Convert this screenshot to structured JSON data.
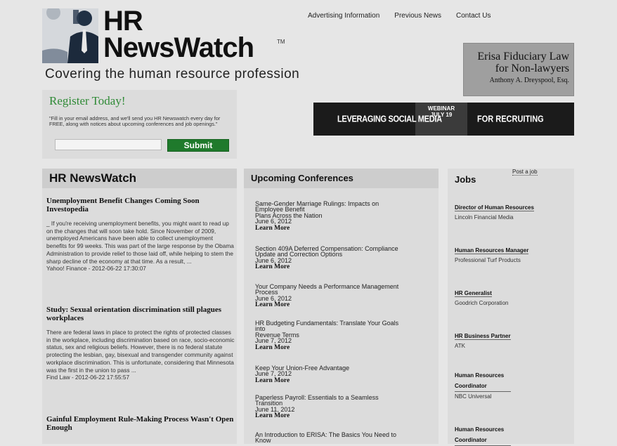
{
  "header": {
    "logo_line1": "HR",
    "logo_line2": "NewsWatch",
    "logo_tm": "TM",
    "tagline": "Covering the human resource profession"
  },
  "topnav": [
    "Advertising Information",
    "Previous News",
    "Contact Us"
  ],
  "erisa_ad": {
    "line1": "Erisa Fiduciary Law",
    "line2": "for Non-lawyers",
    "line3": "Anthony A. Dreyspool, Esq."
  },
  "register": {
    "title": "Register Today!",
    "text": "\"Fill in your email address, and we'll send you HR Newswatch every day for FREE, along with notices about upcoming conferences and job openings.\"",
    "submit_label": "Submit"
  },
  "webinar": {
    "left": "LEVERAGING SOCIAL MEDIA",
    "mid1": "WEBINAR",
    "mid2": "JULY 19",
    "right": "FOR RECRUITING"
  },
  "news": {
    "heading": "HR NewsWatch",
    "items": [
      {
        "title": "Unemployment Benefit Changes Coming Soon Investopedia",
        "body": "_ If you're receiving unemployment benefits, you might want to read up on the changes that will soon take hold. Since November of 2009, unemployed Americans have been able to collect unemployment benefits for 99 weeks. This was part of the large response by the Obama Administration to provide relief to those laid off, while helping to stem the sharp decline of the economy at that time. As a result, ...",
        "source": "Yahoo! Finance - 2012-06-22 17:30:07"
      },
      {
        "title": "Study: Sexual orientation discrimination still plagues workplaces",
        "body": "There are federal laws in place to protect the rights of protected classes in the workplace, including discrimination based on race, socio-economic status, sex and religious beliefs. However, there is no federal statute protecting the lesbian, gay, bisexual and transgender community against workplace discrimination. This is unfortunate, considering that Minnesota was the first in the union to pass ...",
        "source": "Find Law - 2012-06-22 17:55:57"
      },
      {
        "title": "Gainful Employment Rule-Making Process Wasn't Open Enough",
        "body": "",
        "source": ""
      }
    ]
  },
  "conferences": {
    "heading": "Upcoming Conferences",
    "more_label": "Learn More",
    "items": [
      {
        "lines": [
          "Same-Gender Marriage Rulings: Impacts on",
          "Employee Benefit",
          "Plans Across the Nation"
        ],
        "date": "June 6, 2012"
      },
      {
        "lines": [
          "Section 409A Deferred Compensation: Compliance",
          "Update and Correction Options"
        ],
        "date": "June 6, 2012"
      },
      {
        "lines": [
          "Your Company Needs a Performance Management",
          "Process"
        ],
        "date": "June 6, 2012"
      },
      {
        "lines": [
          "HR Budgeting Fundamentals: Translate Your Goals",
          "into",
          "Revenue Terms"
        ],
        "date": "June 7, 2012"
      },
      {
        "lines": [
          "Keep Your Union-Free Advantage"
        ],
        "date": "June 7, 2012"
      },
      {
        "lines": [
          "Paperless Payroll: Essentials to a Seamless",
          "Transition"
        ],
        "date": "June 11, 2012"
      },
      {
        "lines": [
          "An Introduction to ERISA: The Basics You Need to",
          "Know"
        ],
        "date": ""
      }
    ]
  },
  "jobs": {
    "heading": "Jobs",
    "post_label": "Post a job",
    "items": [
      {
        "title": "Director of Human Resources",
        "company": "Lincoln Financial Media"
      },
      {
        "title": "Human Resources Manager",
        "company": "Professional Turf Products"
      },
      {
        "title": "HR Generalist",
        "company": "Goodrich Corporation"
      },
      {
        "title": "HR Business Partner",
        "company": "ATK"
      },
      {
        "title": "Human Resources Coordinator",
        "company": "NBC Universal"
      },
      {
        "title": "Human Resources Coordinator",
        "company": ""
      }
    ]
  }
}
